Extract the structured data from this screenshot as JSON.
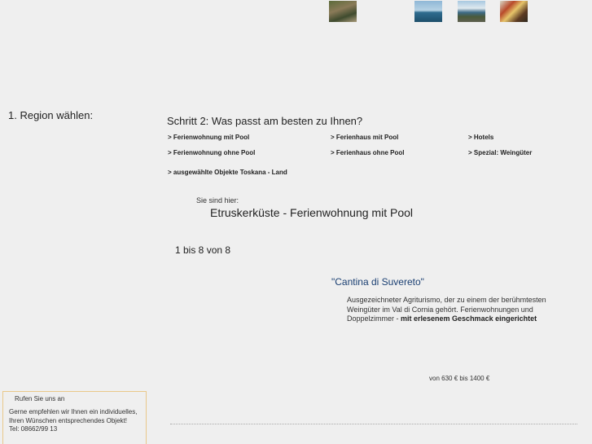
{
  "header": {
    "thumbnails": [
      {
        "icon": "photo-landscape-path"
      },
      {
        "icon": "photo-coast-sea"
      },
      {
        "icon": "photo-coast-town"
      },
      {
        "icon": "photo-market-produce"
      }
    ]
  },
  "region": {
    "heading": "1. Region wählen:"
  },
  "step2": {
    "heading": "Schritt 2: Was passt am besten zu Ihnen?",
    "links": [
      "> Ferienwohnung mit Pool",
      "> Ferienhaus mit Pool",
      "> Hotels",
      "> Ferienwohnung ohne Pool",
      "> Ferienhaus ohne Pool",
      "> Spezial: Weingüter",
      "> ausgewählte Objekte Toskana - Land"
    ]
  },
  "location": {
    "label": "Sie sind hier:",
    "current": "Etruskerküste - Ferienwohnung mit Pool"
  },
  "results": {
    "count_text": "1 bis 8 von 8"
  },
  "listing": {
    "title": "\"Cantina di Suvereto\"",
    "description": "Ausgezeichneter Agriturismo, der zu einem der berühmtesten Weingüter im Val di Cornia gehört. Ferienwohnungen und Doppelzimmer - ",
    "description_bold": "mit erlesenem Geschmack eingerichtet",
    "price": "von 630 € bis 1400 €"
  },
  "contact": {
    "title": "Rufen Sie uns an",
    "body": "Gerne empfehlen wir Ihnen ein individuelles, Ihren Wünschen entsprechendes Objekt!",
    "phone": "Tel: 08662/99 13"
  },
  "colors": {
    "background": "#efefef",
    "listing_title": "#1a3f72",
    "contact_border": "#e9c88a"
  }
}
